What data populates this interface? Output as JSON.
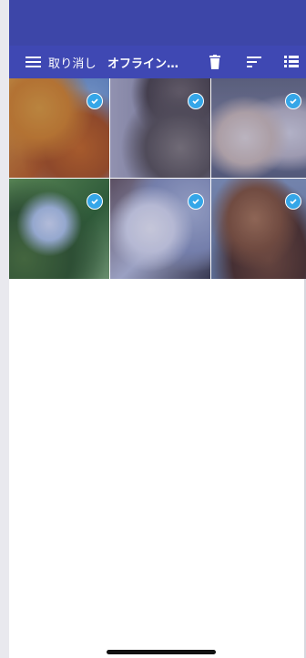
{
  "toolbar": {
    "cancel_label": "取り消し",
    "title": "オフライン…"
  },
  "icons": {
    "menu": "hamburger-menu-icon",
    "trash": "trash-icon",
    "sort": "sort-icon",
    "list": "list-view-icon",
    "check": "check-circle-icon"
  },
  "colors": {
    "toolbar": "#3f48b3",
    "statusbar": "#3d46a8",
    "check": "#35a6e8"
  },
  "photos": [
    {
      "subject": "autumn-leaves",
      "selected": true
    },
    {
      "subject": "cat",
      "selected": true
    },
    {
      "subject": "two-kittens",
      "selected": true
    },
    {
      "subject": "green-trees",
      "selected": true
    },
    {
      "subject": "cherry-blossoms",
      "selected": true
    },
    {
      "subject": "poodle-dog",
      "selected": true
    }
  ]
}
